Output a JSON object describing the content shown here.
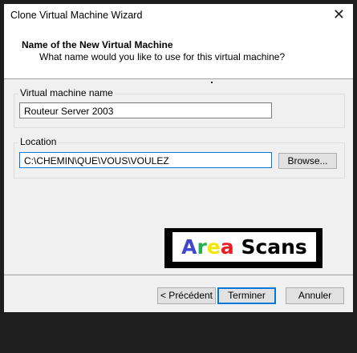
{
  "window": {
    "title": "Clone Virtual Machine Wizard"
  },
  "header": {
    "title": "Name of the New Virtual Machine",
    "subtitle": "What name would you like to use for this virtual machine?"
  },
  "name_group": {
    "label": "Virtual machine name",
    "value": "Routeur Server 2003"
  },
  "location_group": {
    "label": "Location",
    "value": "C:\\CHEMIN\\QUE\\VOUS\\VOULEZ",
    "browse_label": "Browse..."
  },
  "watermark": {
    "text": "Area Scans"
  },
  "buttons": {
    "back": "< Précédent",
    "finish": "Terminer",
    "cancel": "Annuler"
  },
  "colors": {
    "accent": "#0078d7",
    "logo_A": "#3f48cc",
    "logo_r": "#22b14c",
    "logo_e": "#f5e600",
    "logo_a": "#ed1c24"
  }
}
